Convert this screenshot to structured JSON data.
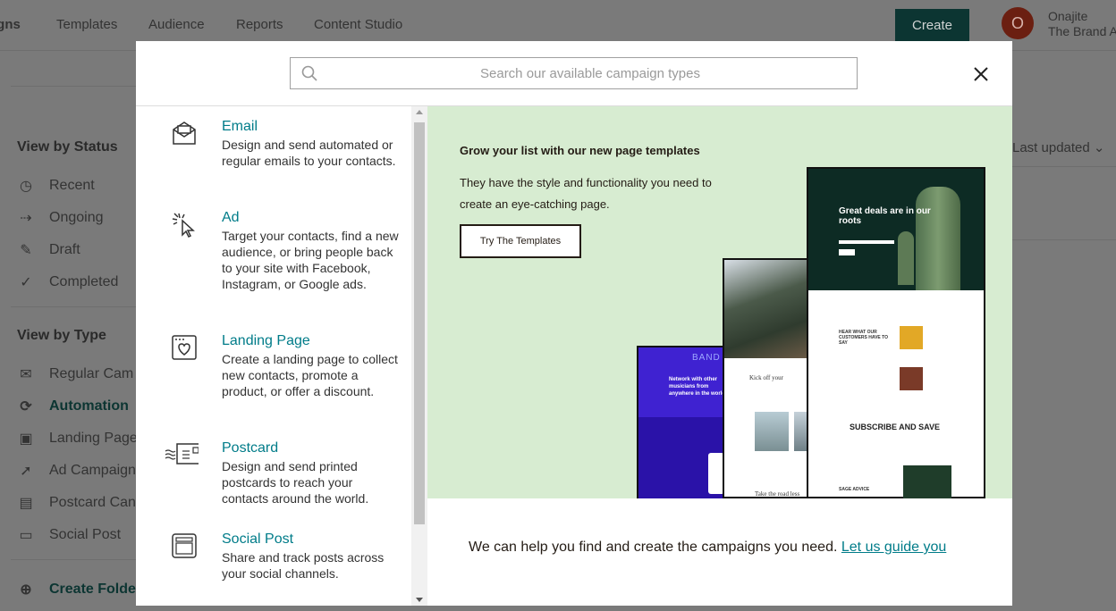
{
  "topnav": {
    "items": [
      "igns",
      "Templates",
      "Audience",
      "Reports",
      "Content Studio"
    ],
    "create_label": "Create",
    "avatar_initial": "O",
    "user_name": "Onajite",
    "user_org": "The Brand A"
  },
  "sidebar": {
    "status_heading": "View by Status",
    "status_items": [
      "Recent",
      "Ongoing",
      "Draft",
      "Completed"
    ],
    "type_heading": "View by Type",
    "type_items": [
      "Regular Cam",
      "Automation",
      "Landing Page",
      "Ad Campaign",
      "Postcard Can",
      "Social Post"
    ],
    "create_folder": "Create Folde"
  },
  "sort": {
    "label": "Last updated"
  },
  "modal": {
    "search_placeholder": "Search our available campaign types",
    "campaign_types": [
      {
        "title": "Email",
        "desc": "Design and send automated or regular emails to your contacts.",
        "icon": "envelope-icon"
      },
      {
        "title": "Ad",
        "desc": "Target your contacts, find a new audience, or bring people back to your site with Facebook, Instagram, or Google ads.",
        "icon": "cursor-click-icon"
      },
      {
        "title": "Landing Page",
        "desc": "Create a landing page to collect new contacts, promote a product, or offer a discount.",
        "icon": "browser-heart-icon"
      },
      {
        "title": "Postcard",
        "desc": "Design and send printed postcards to reach your contacts around the world.",
        "icon": "postcard-icon"
      },
      {
        "title": "Social Post",
        "desc": "Share and track posts across your social channels.",
        "icon": "social-window-icon"
      }
    ],
    "promo": {
      "title": "Grow your list with our new page templates",
      "desc": "They have the style and functionality you need to create an eye-catching page.",
      "button": "Try The Templates",
      "tpl_band": "BAND",
      "tpl_band_text": "Network with other musicians from anywhere in the world",
      "tpl_kick": "Kick off your",
      "tpl_road": "Take the road less",
      "tpl_hero": "Great deals are in our roots",
      "tpl_hear": "HEAR WHAT OUR CUSTOMERS HAVE TO SAY",
      "tpl_subscribe": "SUBSCRIBE AND SAVE",
      "tpl_sage": "SAGE ADVICE"
    },
    "help_text": "We can help you find and create the campaigns you need.",
    "help_link": "Let us guide you"
  }
}
